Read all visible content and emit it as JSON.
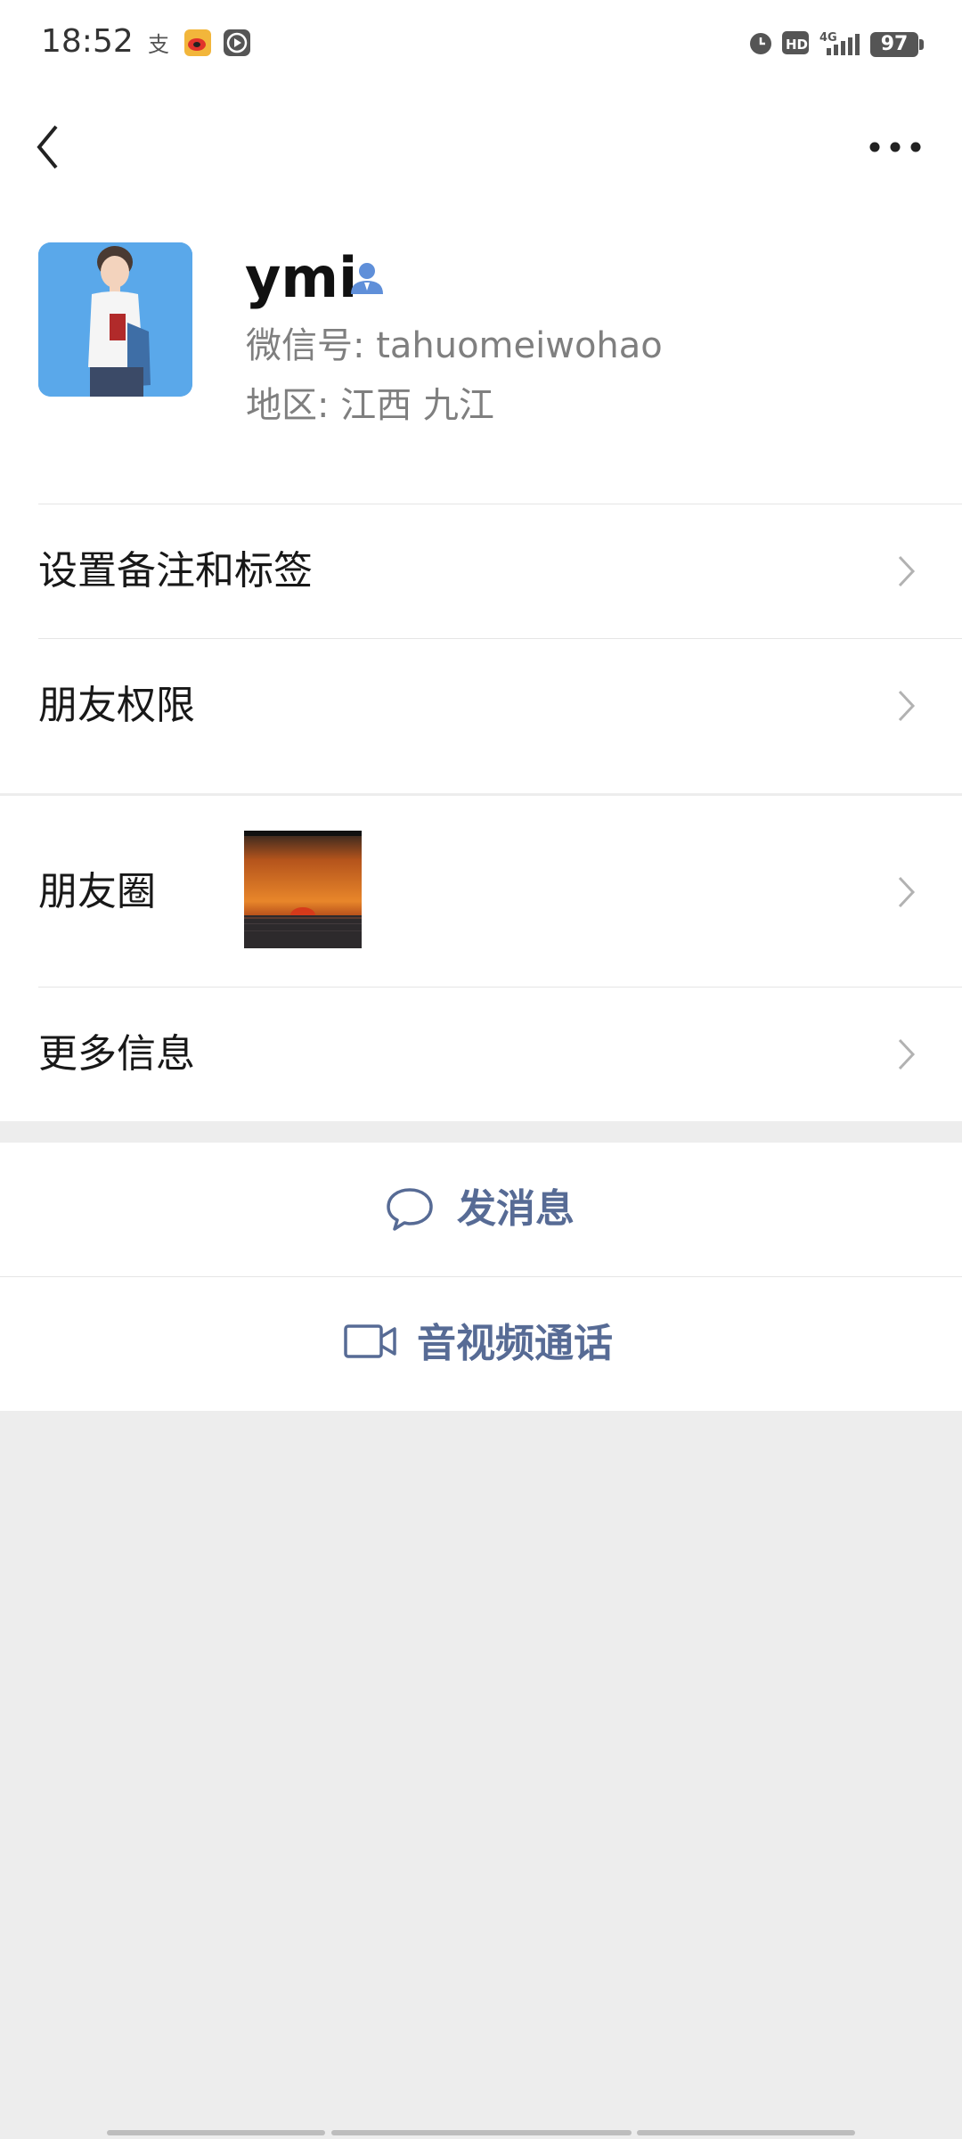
{
  "status_bar": {
    "time": "18:52",
    "battery": "97",
    "icons": [
      "alipay-icon",
      "weibo-icon",
      "video-player-icon",
      "alarm-icon",
      "hd-icon",
      "4g-signal-icon"
    ]
  },
  "nav": {
    "back_icon": "chevron-left-icon",
    "more_icon": "ellipsis-icon"
  },
  "profile": {
    "name": "ymi",
    "wechat_id": "微信号: tahuomeiwohao",
    "region": "地区: 江西  九江"
  },
  "menu": {
    "remark_tags": "设置备注和标签",
    "friend_permissions": "朋友权限",
    "moments": "朋友圈",
    "more_info": "更多信息"
  },
  "actions": {
    "send_message": "发消息",
    "av_call": "音视频通话"
  },
  "colors": {
    "link_blue": "#576b95",
    "background": "#ededed"
  }
}
